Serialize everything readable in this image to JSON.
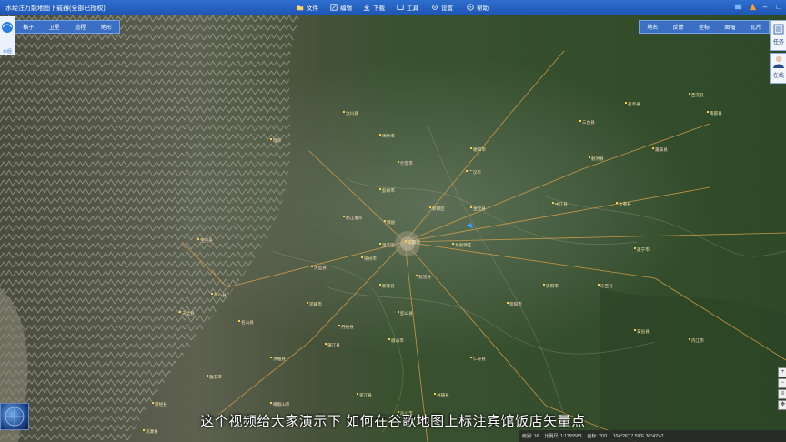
{
  "window": {
    "title": "水经注万能地图下载器(全部已授权)",
    "menu": [
      {
        "label": "文件",
        "icon": "folder-icon"
      },
      {
        "label": "编辑",
        "icon": "edit-icon"
      },
      {
        "label": "下载",
        "icon": "download-icon"
      },
      {
        "label": "工具",
        "icon": "tools-icon"
      },
      {
        "label": "设置",
        "icon": "gear-icon"
      },
      {
        "label": "帮助",
        "icon": "help-icon"
      }
    ]
  },
  "logo": {
    "text": "水经"
  },
  "left_toolbar": [
    "格子",
    "卫星",
    "道程",
    "地形"
  ],
  "right_toolbar": [
    "地名",
    "反馈",
    "坐标",
    "图幅",
    "瓦片"
  ],
  "side_panel": {
    "task_label": "任务",
    "online_label": "在线"
  },
  "map": {
    "cities": [
      "理县",
      "汶川县",
      "崇州市",
      "都江堰市",
      "彭州市",
      "郫县",
      "温江区",
      "新都区",
      "成都市",
      "大邑县",
      "邛崃市",
      "新津县",
      "双流县",
      "龙泉驿区",
      "金堂县",
      "简阳市",
      "广汉市",
      "德阳市",
      "什邡市",
      "绵竹市",
      "中江县",
      "蒲江县",
      "眉山市",
      "彭山县",
      "丹棱县",
      "洪雅县",
      "芦山县",
      "名山县",
      "雅安市",
      "天全县",
      "宝兴县",
      "荥经县",
      "汉源县",
      "仁寿县",
      "井研县",
      "资阳市",
      "乐至县",
      "遂宁市",
      "安岳县",
      "内江市",
      "夹江县",
      "乐山市",
      "峨眉山市",
      "射洪县",
      "大英县",
      "蓬溪县",
      "南部县",
      "西充县",
      "三台县",
      "盐亭县"
    ]
  },
  "statusbar": {
    "level": "级别: 16",
    "scale": "比例尺: 1:1155583",
    "coordinate_mode": "坐标: 20/1",
    "lon_lat": "104°26'17.59\"E  30°42'47"
  },
  "subtitle": "这个视频给大家演示下 如何在谷歌地图上标注宾馆饭店矢量点"
}
